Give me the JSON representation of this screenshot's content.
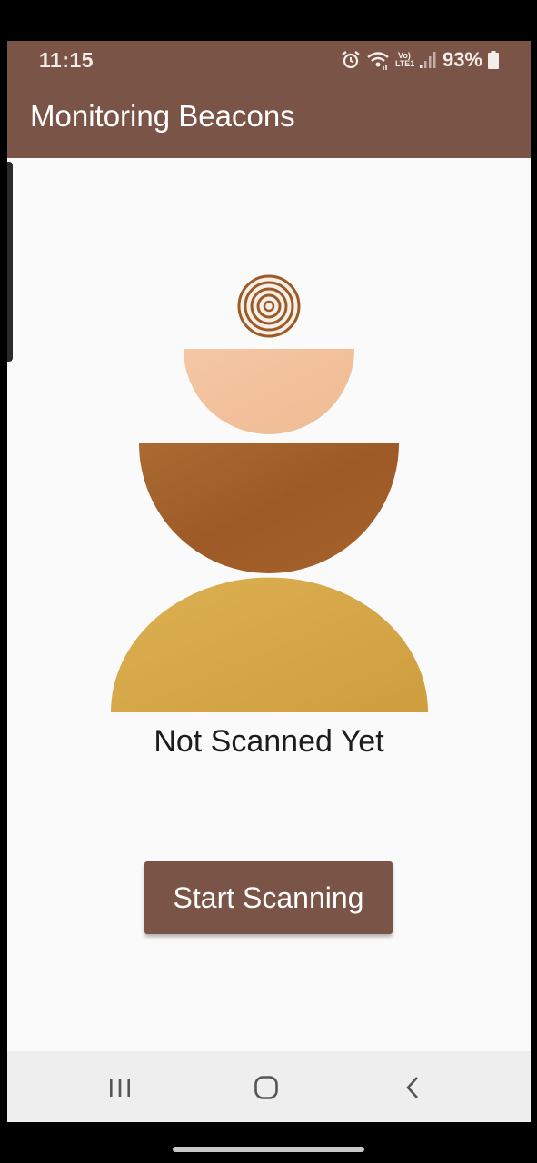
{
  "status_bar": {
    "time": "11:15",
    "lte_top": "Vo)",
    "lte_bottom": "LTE1",
    "battery": "93%"
  },
  "app_bar": {
    "title": "Monitoring Beacons"
  },
  "main": {
    "status_text": "Not Scanned Yet",
    "start_button_label": "Start Scanning"
  },
  "nav": {
    "recents_icon": "recents-icon",
    "home_icon": "home-icon",
    "back_icon": "back-icon"
  },
  "colors": {
    "primary": "#7a5446",
    "background": "#fafafa",
    "peach": "#f2c09a",
    "rust": "#a4602a",
    "mustard": "#d5a646"
  }
}
